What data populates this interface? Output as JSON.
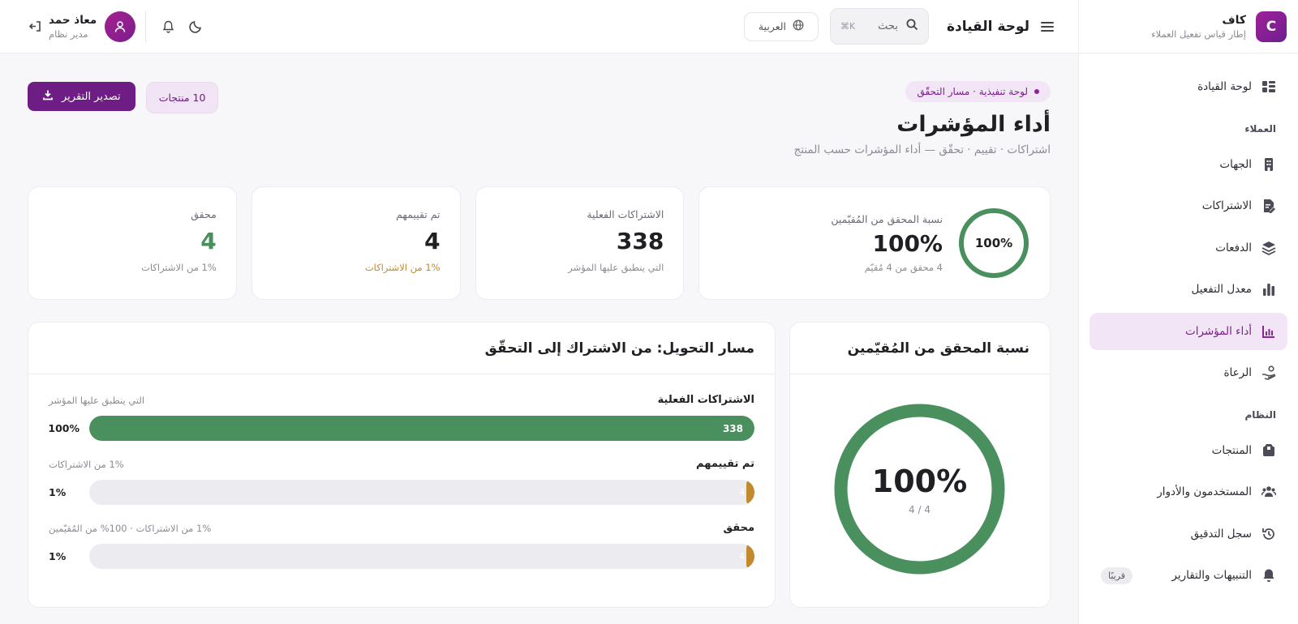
{
  "brand": {
    "logo_letter": "C",
    "name": "كاف",
    "subtitle": "إطار قياس تفعيل العملاء"
  },
  "sidebar": {
    "items": [
      {
        "label": "لوحة القيادة",
        "icon": "dashboard-icon"
      },
      {
        "section": "العملاء"
      },
      {
        "label": "الجهات",
        "icon": "building-icon"
      },
      {
        "label": "الاشتراكات",
        "icon": "subscription-icon"
      },
      {
        "label": "الدفعات",
        "icon": "layers-icon"
      },
      {
        "label": "معدل التفعيل",
        "icon": "bar-chart-icon"
      },
      {
        "label": "أداء المؤشرات",
        "icon": "kpi-chart-icon",
        "active": true
      },
      {
        "label": "الرعاة",
        "icon": "hand-coins-icon"
      },
      {
        "section": "النظام"
      },
      {
        "label": "المنتجات",
        "icon": "package-icon"
      },
      {
        "label": "المستخدمون والأدوار",
        "icon": "users-icon"
      },
      {
        "label": "سجل التدقيق",
        "icon": "history-icon"
      },
      {
        "label": "التنبيهات والتقارير",
        "icon": "bell-icon",
        "badge": "قريبًا"
      }
    ]
  },
  "header": {
    "title": "لوحة القيادة",
    "search_placeholder": "بحث",
    "search_shortcut": "K⌘",
    "language": "العربية",
    "user_name": "معاذ حمد",
    "user_role": "مدير نظام"
  },
  "main": {
    "pill": "لوحة تنفيذية · مسار التحقّق",
    "title": "أداء المؤشرات",
    "subtitle": "اشتراكات · تقييم · تحقّق — أداء المؤشرات حسب المنتج",
    "export_label": "تصدير التقرير",
    "products_count": "10 منتجات"
  },
  "stats": [
    {
      "label": "نسبة المحقق من المُقيّمين",
      "value": "100%",
      "note": "4 محقق من 4 مُقيّم",
      "ring_text": "100%",
      "ring_fraction": 1.0
    },
    {
      "label": "الاشتراكات الفعلية",
      "value": "338",
      "note": "التي ينطبق عليها المؤشر"
    },
    {
      "label": "تم تقييمهم",
      "value": "4",
      "note": "1% من الاشتراكات"
    },
    {
      "label": "محقق",
      "value": "4",
      "note": "1% من الاشتراكات"
    }
  ],
  "ring_card": {
    "title": "نسبة المحقق من المُقيّمين",
    "value": "100%",
    "ratio": "4 / 4",
    "fraction": 1.0
  },
  "funnel": {
    "title": "مسار التحويل: من الاشتراك إلى التحقّق",
    "rows": [
      {
        "label": "الاشتراكات الفعلية",
        "note": "التي ينطبق عليها المؤشر",
        "value": "338",
        "pct": "100%",
        "fraction": 1.0
      },
      {
        "label": "تم تقييمهم",
        "note": "1% من الاشتراكات",
        "value": "4",
        "pct": "1%",
        "fraction": 0.012
      },
      {
        "label": "محقق",
        "note": "1% من الاشتراكات · 100% من المُقيّمين",
        "value": "4",
        "pct": "1%",
        "fraction": 0.012
      }
    ]
  },
  "colors": {
    "accent": "#7b1e8c",
    "success": "#4a8f5e",
    "warning": "#c08a2d"
  }
}
